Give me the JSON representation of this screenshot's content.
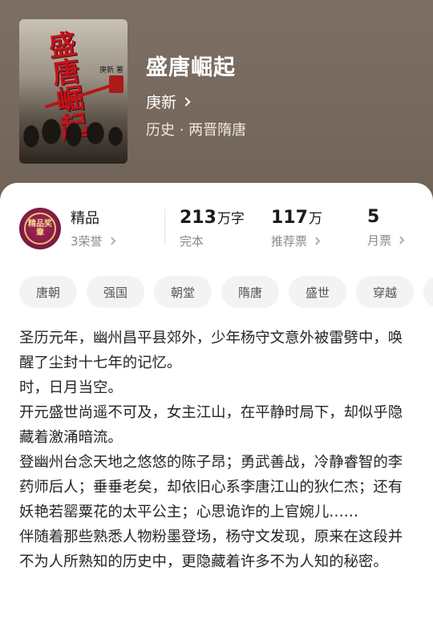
{
  "book": {
    "title": "盛唐崛起",
    "author": "庚新",
    "genre": "历史 · 两晋隋唐",
    "cover": {
      "title_text": "盛唐崛起",
      "author_text": "庚新 著"
    }
  },
  "quality": {
    "label": "精品",
    "honor": "3荣誉",
    "badge_text": "精品奖章"
  },
  "stats": {
    "words": {
      "value": "213",
      "unit": "万字",
      "label": "完本"
    },
    "recommend": {
      "value": "117",
      "unit": "万",
      "label": "推荐票"
    },
    "monthly": {
      "value": "5",
      "unit": "",
      "label": "月票"
    }
  },
  "tags": [
    "唐朝",
    "强国",
    "朝堂",
    "隋唐",
    "盛世",
    "穿越"
  ],
  "description": [
    "圣历元年，幽州昌平县郊外，少年杨守文意外被雷劈中，唤醒了尘封十七年的记忆。",
    "时，日月当空。",
    "开元盛世尚遥不可及，女主江山，在平静时局下，却似乎隐藏着激涌暗流。",
    "登幽州台念天地之悠悠的陈子昂；勇武善战，冷静睿智的李药师后人；垂垂老矣，却依旧心系李唐江山的狄仁杰；还有妖艳若罂粟花的太平公主；心思诡诈的上官婉儿……",
    "伴随着那些熟悉人物粉墨登场，杨守文发现，原来在这段并不为人所熟知的历史中，更隐藏着许多不为人知的秘密。"
  ],
  "colors": {
    "header_bg": "#76685d",
    "card_bg": "#ffffff",
    "tag_bg": "#f3f3f3",
    "badge": "#7b1a40"
  }
}
